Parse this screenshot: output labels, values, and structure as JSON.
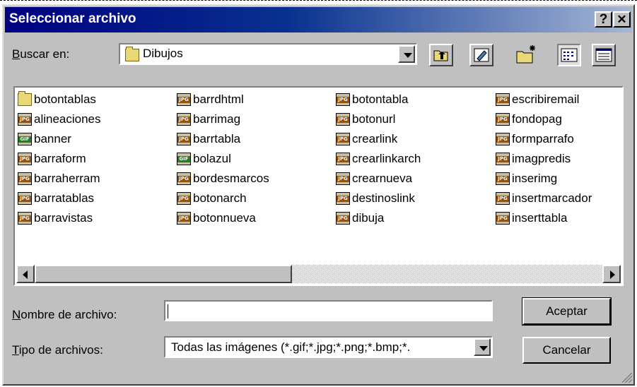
{
  "dialog": {
    "title": "Seleccionar archivo",
    "help_label": "?",
    "close_label": "✕"
  },
  "lookin": {
    "label_hot": "B",
    "label_rest": "uscar en:",
    "value": "Dibujos"
  },
  "toolbar": {
    "icons": [
      "up-folder-icon",
      "desktop-icon",
      "new-folder-icon",
      "list-view-icon",
      "details-view-icon"
    ]
  },
  "files": {
    "columns": [
      [
        {
          "name": "botontablas",
          "type": "folder"
        },
        {
          "name": "alineaciones",
          "type": "JPG"
        },
        {
          "name": "banner",
          "type": "GIF"
        },
        {
          "name": "barraform",
          "type": "JPG"
        },
        {
          "name": "barraherram",
          "type": "JPG"
        },
        {
          "name": "barratablas",
          "type": "JPG"
        },
        {
          "name": "barravistas",
          "type": "JPG"
        }
      ],
      [
        {
          "name": "barrdhtml",
          "type": "JPG"
        },
        {
          "name": "barrimag",
          "type": "JPG"
        },
        {
          "name": "barrtabla",
          "type": "JPG"
        },
        {
          "name": "bolazul",
          "type": "GIF"
        },
        {
          "name": "bordesmarcos",
          "type": "JPG"
        },
        {
          "name": "botonarch",
          "type": "JPG"
        },
        {
          "name": "botonnueva",
          "type": "JPG"
        }
      ],
      [
        {
          "name": "botontabla",
          "type": "JPG"
        },
        {
          "name": "botonurl",
          "type": "JPG"
        },
        {
          "name": "crearlink",
          "type": "JPG"
        },
        {
          "name": "crearlinkarch",
          "type": "JPG"
        },
        {
          "name": "crearnueva",
          "type": "JPG"
        },
        {
          "name": "destinoslink",
          "type": "JPG"
        },
        {
          "name": "dibuja",
          "type": "JPG"
        }
      ],
      [
        {
          "name": "escribiremail",
          "type": "JPG"
        },
        {
          "name": "fondopag",
          "type": "JPG"
        },
        {
          "name": "formparrafo",
          "type": "JPG"
        },
        {
          "name": "imagpredis",
          "type": "JPG"
        },
        {
          "name": "inserimg",
          "type": "JPG"
        },
        {
          "name": "insertmarcador",
          "type": "JPG"
        },
        {
          "name": "inserttabla",
          "type": "JPG"
        }
      ]
    ]
  },
  "filename": {
    "label_hot": "N",
    "label_rest": "ombre de archivo:",
    "value": ""
  },
  "filetype": {
    "label_hot": "T",
    "label_rest": "ipo de archivos:",
    "value": "Todas las imágenes (*.gif;*.jpg;*.png;*.bmp;*."
  },
  "buttons": {
    "accept": "Aceptar",
    "cancel": "Cancelar"
  },
  "colors": {
    "title_start": "#000080",
    "title_end": "#a6b7d6",
    "face": "#c0c0c0",
    "jpg_band": "#a05000",
    "gif_band": "#208020"
  }
}
